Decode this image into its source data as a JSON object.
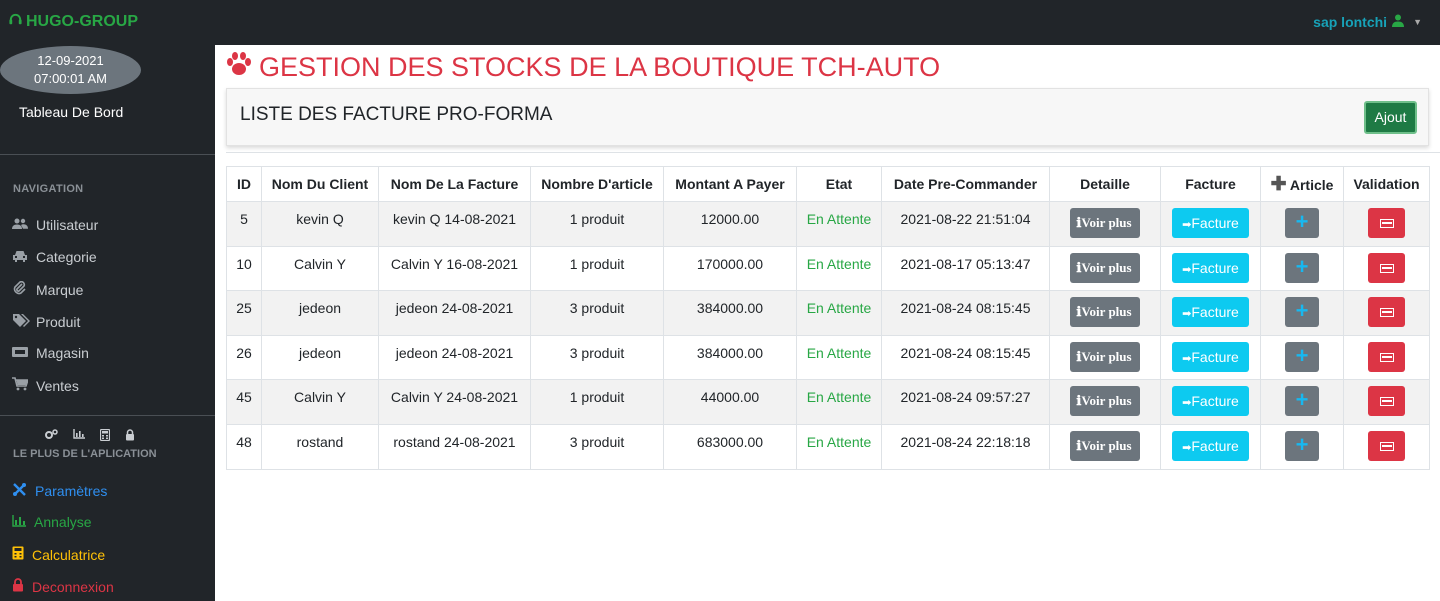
{
  "header": {
    "brand": "HUGO-GROUP",
    "user": "sap lontchi"
  },
  "sidebar": {
    "date": "12-09-2021",
    "time": "07:00:01 AM",
    "dashboard": "Tableau De Bord",
    "nav_title": "NAVIGATION",
    "items": [
      {
        "label": "Utilisateur",
        "icon": "users-icon"
      },
      {
        "label": "Categorie",
        "icon": "car-icon"
      },
      {
        "label": "Marque",
        "icon": "paperclip-icon"
      },
      {
        "label": "Produit",
        "icon": "tags-icon"
      },
      {
        "label": "Magasin",
        "icon": "store-icon"
      },
      {
        "label": "Ventes",
        "icon": "cart-icon"
      }
    ],
    "extras_title": "LE PLUS DE L'APLICATION",
    "extras": [
      {
        "label": "Paramètres",
        "icon": "tools-icon",
        "color": "#2f8ff0"
      },
      {
        "label": "Annalyse",
        "icon": "chart-icon",
        "color": "#28a745"
      },
      {
        "label": "Calculatrice",
        "icon": "calculator-icon",
        "color": "#ffc107"
      },
      {
        "label": "Deconnexion",
        "icon": "lock-icon",
        "color": "#dc3545"
      }
    ]
  },
  "page": {
    "title": "GESTION DES STOCKS DE LA BOUTIQUE TCH-AUTO",
    "card_title": "LISTE DES FACTURE PRO-FORMA",
    "add_button": "Ajout"
  },
  "table": {
    "headers": [
      "ID",
      "Nom Du Client",
      "Nom De La Facture",
      "Nombre D'article",
      "Montant A Payer",
      "Etat",
      "Date Pre-Commander",
      "Detaille",
      "Facture",
      "Article",
      "Validation"
    ],
    "buttons": {
      "detail": "Voir plus",
      "facture": "Facture",
      "add": "+"
    },
    "rows": [
      {
        "id": "5",
        "client": "kevin Q",
        "facture": "kevin Q 14-08-2021",
        "nombre": "1 produit",
        "montant": "12000.00",
        "etat": "En Attente",
        "date": "2021-08-22 21:51:04"
      },
      {
        "id": "10",
        "client": "Calvin Y",
        "facture": "Calvin Y 16-08-2021",
        "nombre": "1 produit",
        "montant": "170000.00",
        "etat": "En Attente",
        "date": "2021-08-17 05:13:47"
      },
      {
        "id": "25",
        "client": "jedeon",
        "facture": "jedeon 24-08-2021",
        "nombre": "3 produit",
        "montant": "384000.00",
        "etat": "En Attente",
        "date": "2021-08-24 08:15:45"
      },
      {
        "id": "26",
        "client": "jedeon",
        "facture": "jedeon 24-08-2021",
        "nombre": "3 produit",
        "montant": "384000.00",
        "etat": "En Attente",
        "date": "2021-08-24 08:15:45"
      },
      {
        "id": "45",
        "client": "Calvin Y",
        "facture": "Calvin Y 24-08-2021",
        "nombre": "1 produit",
        "montant": "44000.00",
        "etat": "En Attente",
        "date": "2021-08-24 09:57:27"
      },
      {
        "id": "48",
        "client": "rostand",
        "facture": "rostand 24-08-2021",
        "nombre": "3 produit",
        "montant": "683000.00",
        "etat": "En Attente",
        "date": "2021-08-24 22:18:18"
      }
    ]
  }
}
